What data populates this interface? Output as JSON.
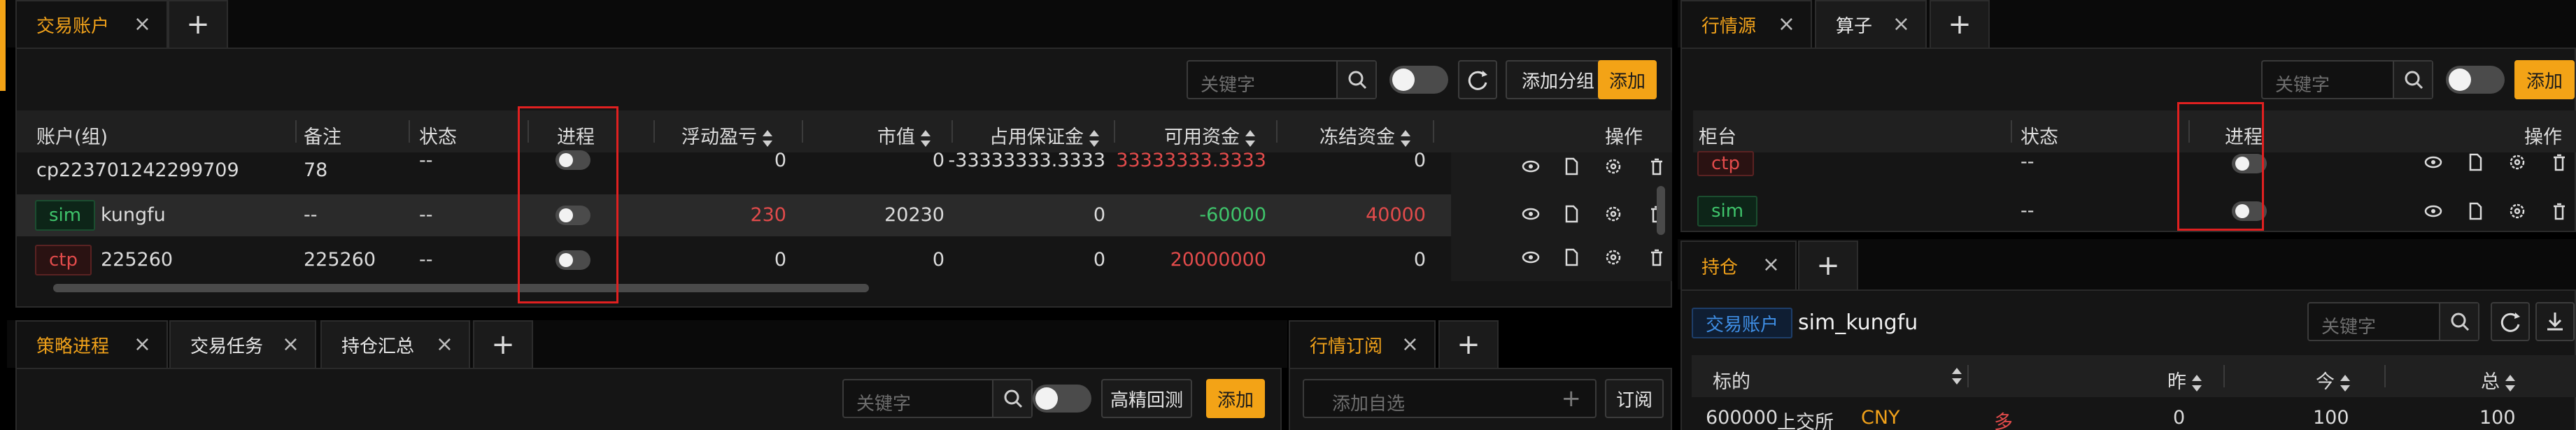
{
  "colors": {
    "accent": "#f3a316",
    "positive": "#e24b4b",
    "negative": "#3fc46b",
    "link": "#3f8fe6"
  },
  "accounts_tabs": {
    "active": "交易账户",
    "add": "+"
  },
  "accounts_toolbar": {
    "search_placeholder": "关键字",
    "add_group": "添加分组",
    "add": "添加"
  },
  "accounts_table": {
    "headers": [
      "账户(组)",
      "备注",
      "状态",
      "进程",
      "浮动盈亏",
      "市值",
      "占用保证金",
      "可用资金",
      "冻结资金",
      "操作"
    ],
    "rows": [
      {
        "account": "cp223701242299709",
        "note": "78",
        "status": "--",
        "pnl": "0",
        "market": "0",
        "margin": "-33333333.3333",
        "available": "33333333.3333",
        "frozen": "0"
      },
      {
        "badge": "sim",
        "account": "kungfu",
        "note": "--",
        "status": "--",
        "pnl": "230",
        "market": "20230",
        "margin": "0",
        "available": "-60000",
        "frozen": "40000"
      },
      {
        "badge": "ctp",
        "account": "225260",
        "note": "225260",
        "status": "--",
        "pnl": "0",
        "market": "0",
        "margin": "0",
        "available": "20000000",
        "frozen": "0"
      }
    ]
  },
  "strategy_tabs": [
    "策略进程",
    "交易任务",
    "持仓汇总"
  ],
  "strategy_toolbar": {
    "search_placeholder": "关键字",
    "backtest": "高精回测",
    "add": "添加"
  },
  "subscribe_tabs": [
    "行情订阅"
  ],
  "subscribe_toolbar": {
    "placeholder": "添加自选",
    "subscribe": "订阅"
  },
  "md_tabs": [
    "行情源",
    "算子"
  ],
  "md_toolbar": {
    "search_placeholder": "关键字",
    "add": "添加"
  },
  "md_table": {
    "headers": [
      "柜台",
      "状态",
      "进程",
      "操作"
    ],
    "rows": [
      {
        "badge": "ctp",
        "status": "--"
      },
      {
        "badge": "sim",
        "status": "--"
      }
    ]
  },
  "position_tabs": [
    "持仓"
  ],
  "position_header": {
    "badge": "交易账户",
    "account": "sim_kungfu",
    "search_placeholder": "关键字"
  },
  "position_table": {
    "headers": [
      "标的",
      "昨",
      "今",
      "总"
    ],
    "rows": [
      {
        "code": "600000",
        "exchange": "上交所",
        "currency": "CNY",
        "direction": "多",
        "yd": "0",
        "td": "100",
        "total": "100"
      }
    ]
  }
}
